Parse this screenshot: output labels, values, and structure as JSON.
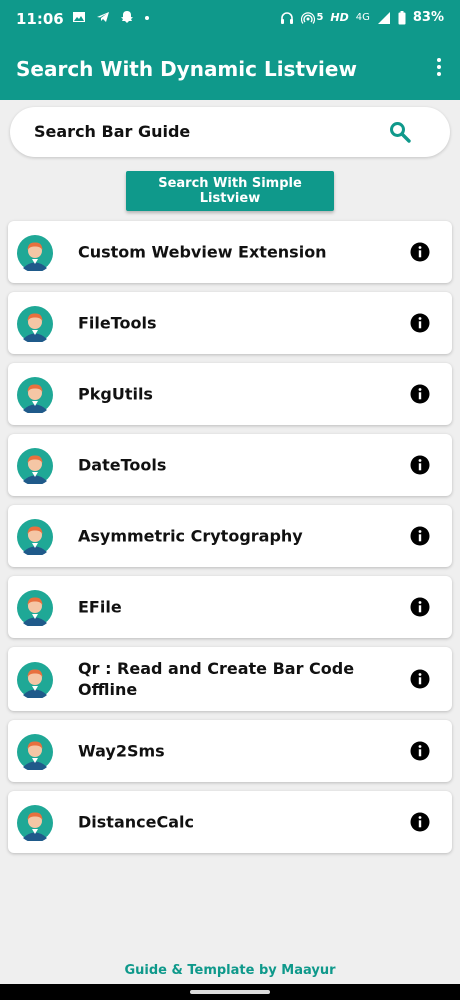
{
  "status_bar": {
    "time": "11:06",
    "left_icons": [
      "image-icon",
      "telegram-icon",
      "snapchat-icon",
      "dot-icon"
    ],
    "hd_label": "HD",
    "network": "4G",
    "signal_sub": "5",
    "battery": "83%"
  },
  "app_bar": {
    "title": "Search With Dynamic Listview",
    "menu_icon": "more-vertical-icon"
  },
  "search": {
    "text": "Search Bar Guide",
    "icon": "search-icon"
  },
  "simple_button": {
    "label": "Search With Simple Listview"
  },
  "list": {
    "items": [
      {
        "label": "Custom Webview Extension"
      },
      {
        "label": "FileTools"
      },
      {
        "label": "PkgUtils"
      },
      {
        "label": "DateTools"
      },
      {
        "label": "Asymmetric Crytography"
      },
      {
        "label": "EFile"
      },
      {
        "label": "Qr : Read and Create Bar Code Offline"
      },
      {
        "label": "Way2Sms"
      },
      {
        "label": "DistanceCalc"
      }
    ]
  },
  "footer": {
    "text": "Guide & Template by Maayur"
  },
  "colors": {
    "primary": "#0f998b",
    "background": "#efefef",
    "avatar_bg": "#1fa896",
    "hair": "#e8703e",
    "shirt": "#1f5a8a"
  }
}
